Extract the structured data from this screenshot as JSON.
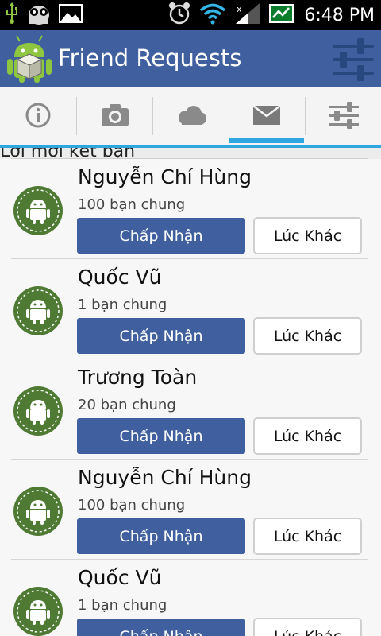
{
  "status_bar": {
    "time": "6:48 PM",
    "left_icons": [
      "usb-icon",
      "android-debug-icon",
      "image-notification-icon"
    ],
    "right_icons": [
      "alarm-clock-icon",
      "wifi-icon",
      "signal-icon",
      "battery-icon"
    ]
  },
  "app_bar": {
    "title": "Friend Requests",
    "logo_icon": "android-box-logo-icon",
    "settings_icon": "sliders-icon"
  },
  "tabs": [
    {
      "icon": "info-icon",
      "selected": false
    },
    {
      "icon": "camera-icon",
      "selected": false
    },
    {
      "icon": "cloud-icon",
      "selected": false
    },
    {
      "icon": "mail-icon",
      "selected": true
    },
    {
      "icon": "sliders-icon",
      "selected": false
    }
  ],
  "list": {
    "clipped_text": "Lời mời kết bạn",
    "items": [
      {
        "name": "Nguyễn Chí Hùng",
        "mutual": "100 bạn chung",
        "accept": "Chấp Nhận",
        "later": "Lúc Khác"
      },
      {
        "name": "Quốc Vũ",
        "mutual": "1 bạn chung",
        "accept": "Chấp Nhận",
        "later": "Lúc Khác"
      },
      {
        "name": "Trương Toàn",
        "mutual": "20 bạn chung",
        "accept": "Chấp Nhận",
        "later": "Lúc Khác"
      },
      {
        "name": "Nguyễn Chí Hùng",
        "mutual": "100 bạn chung",
        "accept": "Chấp Nhận",
        "later": "Lúc Khác"
      },
      {
        "name": "Quốc Vũ",
        "mutual": "1 bạn chung",
        "accept": "Chấp Nhận",
        "later": "Lúc Khác"
      }
    ]
  },
  "colors": {
    "app_bar": "#3f5f9e",
    "accept_button": "#3f5f9e",
    "tab_indicator": "#2ea6e0",
    "avatar_green": "#4f7a34"
  }
}
